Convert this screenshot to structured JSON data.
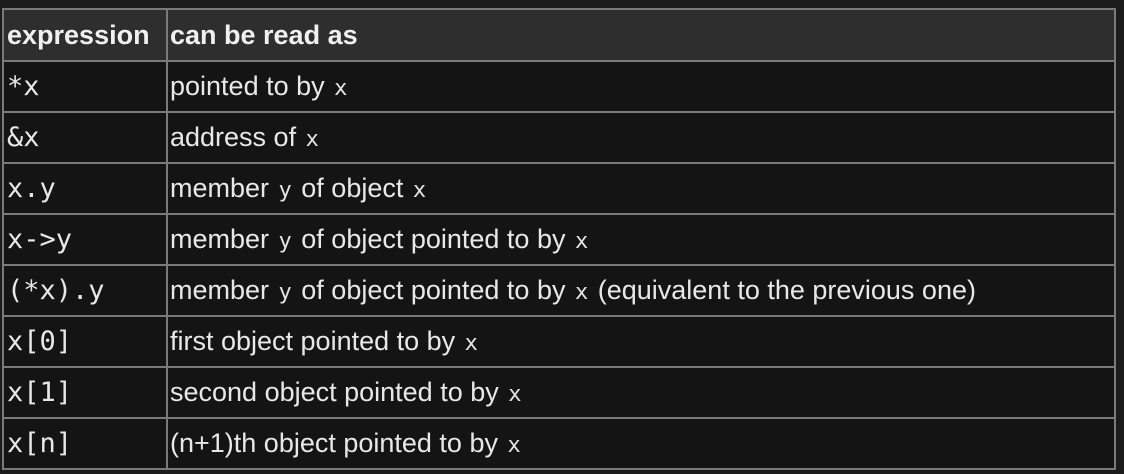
{
  "table": {
    "headers": [
      "expression",
      "can be read as"
    ],
    "rows": [
      {
        "expression": "*x",
        "meaning": [
          {
            "t": "text",
            "v": "pointed to by "
          },
          {
            "t": "code",
            "v": "x"
          }
        ]
      },
      {
        "expression": "&x",
        "meaning": [
          {
            "t": "text",
            "v": "address of "
          },
          {
            "t": "code",
            "v": "x"
          }
        ]
      },
      {
        "expression": "x.y",
        "meaning": [
          {
            "t": "text",
            "v": "member "
          },
          {
            "t": "code",
            "v": "y"
          },
          {
            "t": "text",
            "v": " of object "
          },
          {
            "t": "code",
            "v": "x"
          }
        ]
      },
      {
        "expression": "x->y",
        "meaning": [
          {
            "t": "text",
            "v": "member "
          },
          {
            "t": "code",
            "v": "y"
          },
          {
            "t": "text",
            "v": " of object pointed to by "
          },
          {
            "t": "code",
            "v": "x"
          }
        ]
      },
      {
        "expression": "(*x).y",
        "meaning": [
          {
            "t": "text",
            "v": "member "
          },
          {
            "t": "code",
            "v": "y"
          },
          {
            "t": "text",
            "v": " of object pointed to by "
          },
          {
            "t": "code",
            "v": "x"
          },
          {
            "t": "text",
            "v": " (equivalent to the previous one)"
          }
        ]
      },
      {
        "expression": "x[0]",
        "meaning": [
          {
            "t": "text",
            "v": "first object pointed to by "
          },
          {
            "t": "code",
            "v": "x"
          }
        ]
      },
      {
        "expression": "x[1]",
        "meaning": [
          {
            "t": "text",
            "v": "second object pointed to by "
          },
          {
            "t": "code",
            "v": "x"
          }
        ]
      },
      {
        "expression": "x[n]",
        "meaning": [
          {
            "t": "text",
            "v": "(n+1)th object pointed to by "
          },
          {
            "t": "code",
            "v": "x"
          }
        ]
      }
    ]
  }
}
